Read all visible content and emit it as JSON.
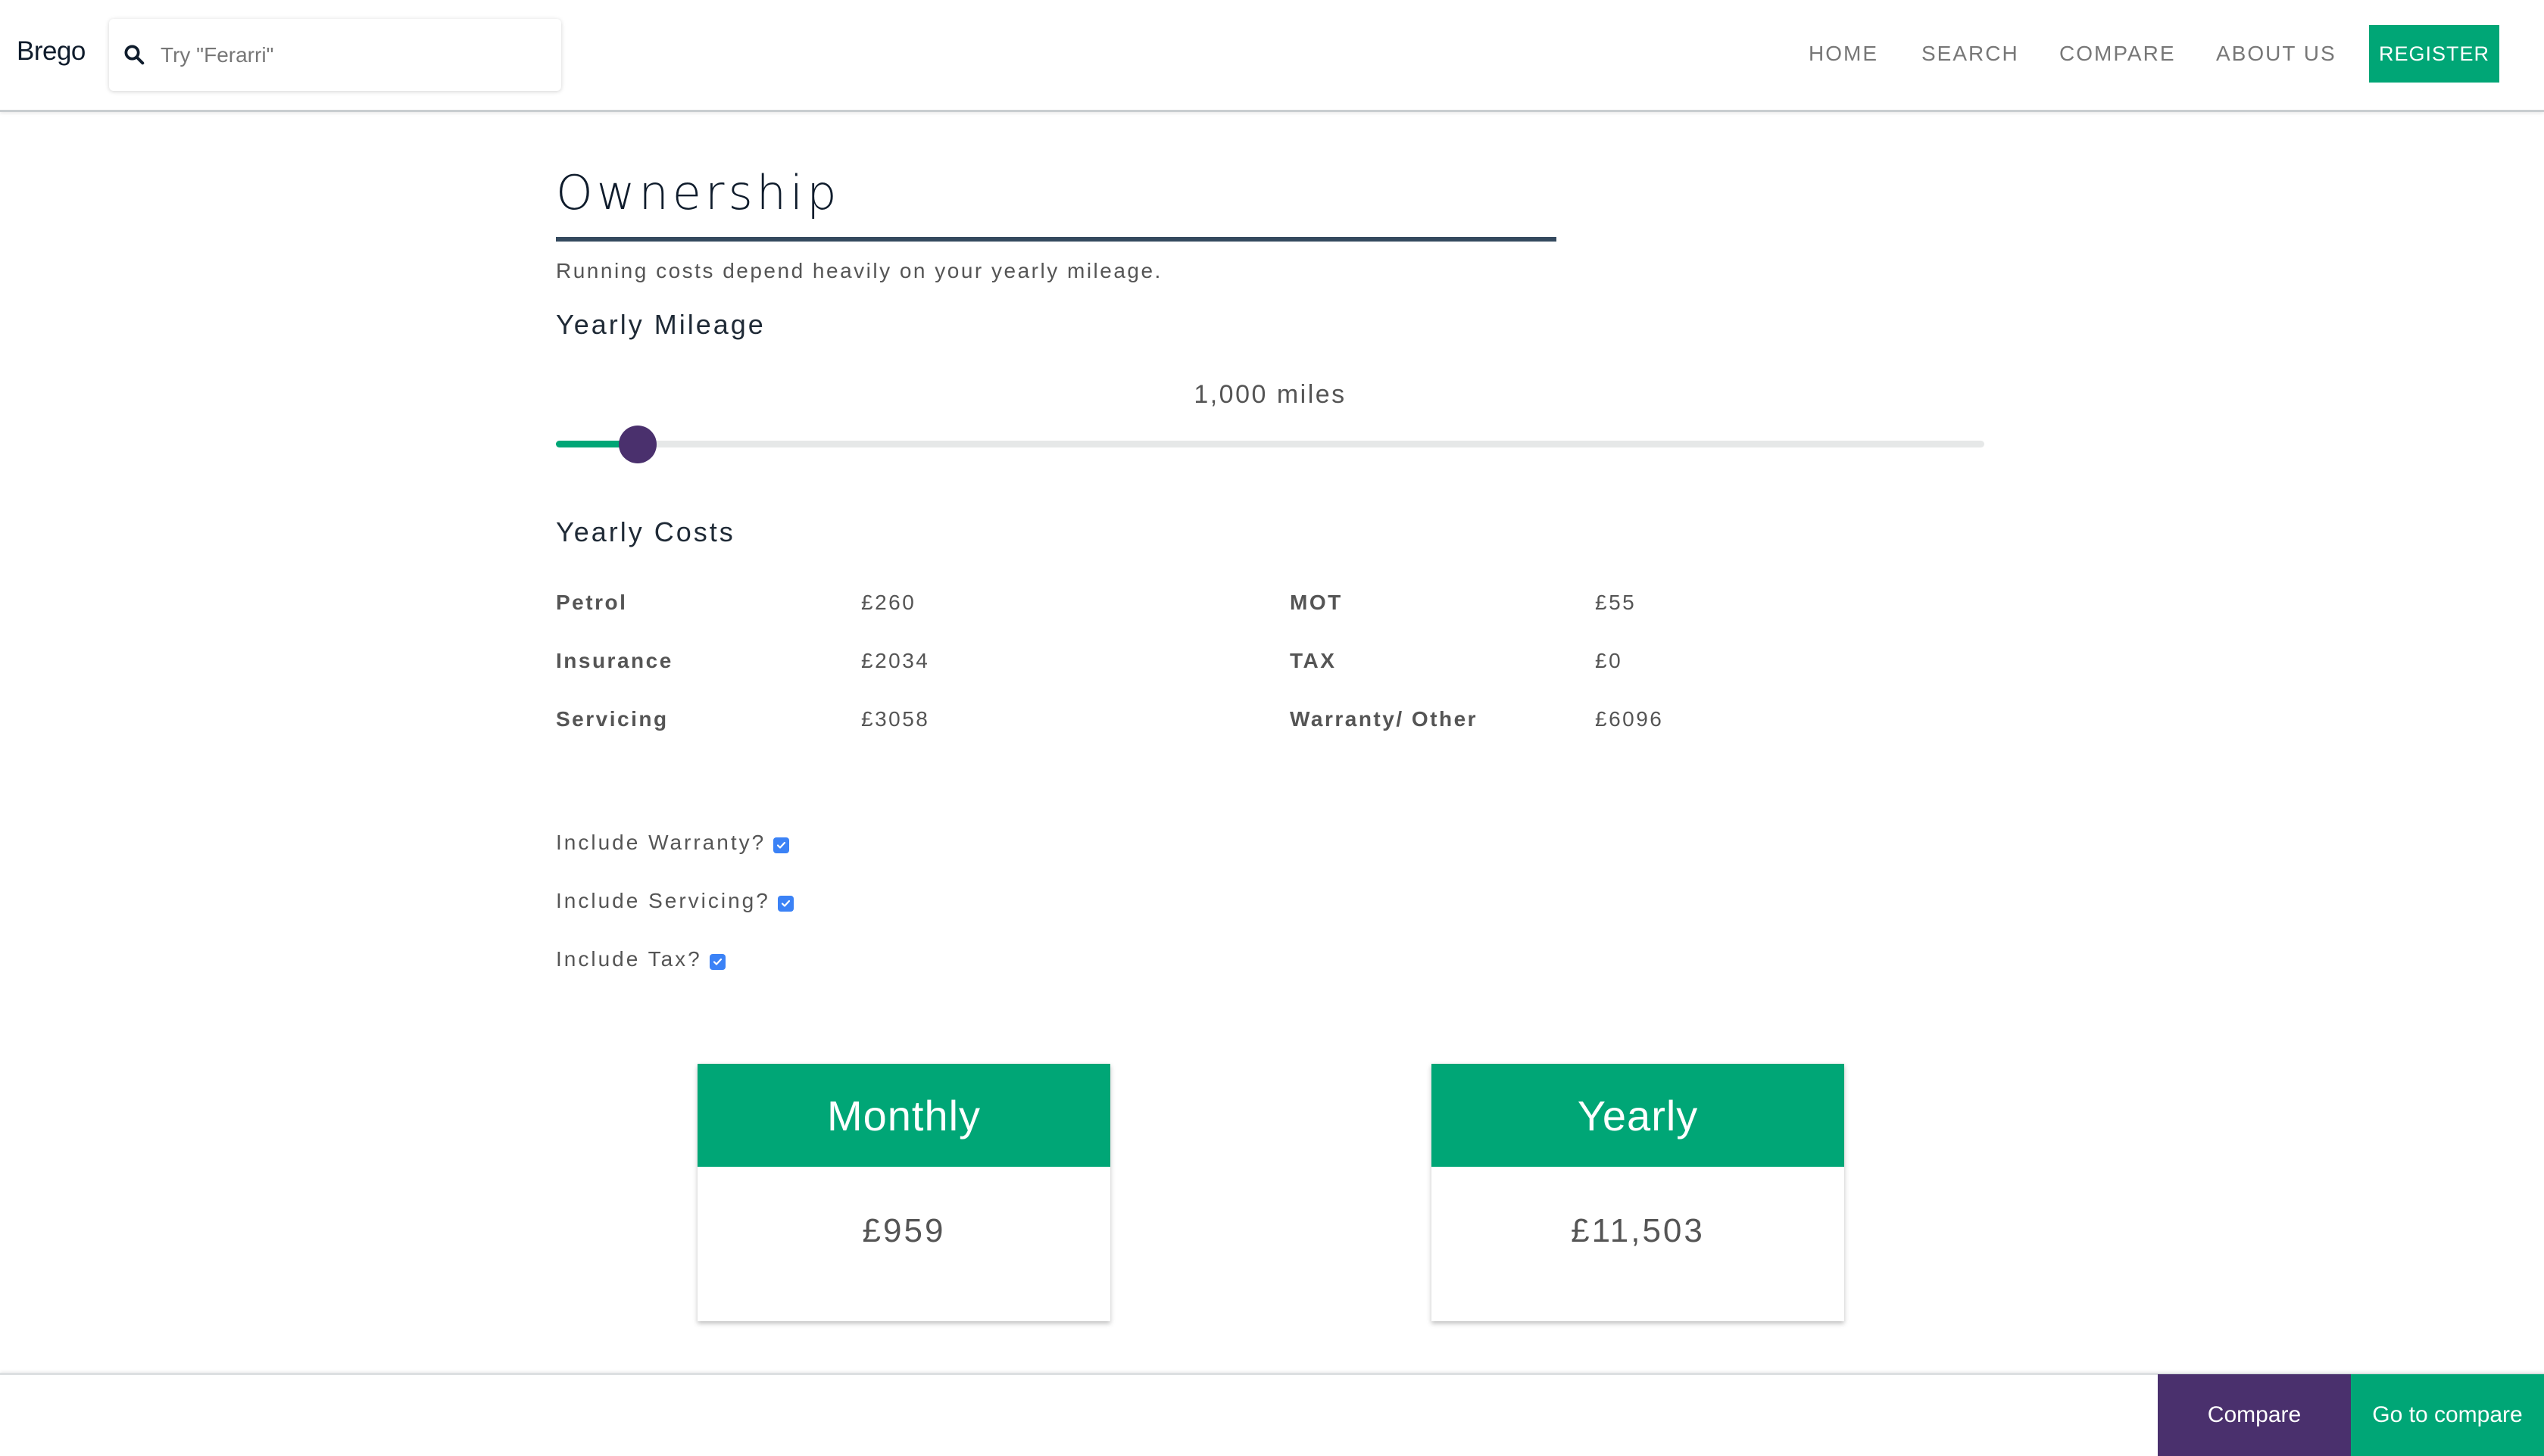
{
  "header": {
    "logo": "Brego",
    "search": {
      "placeholder": "Try \"Ferarri\"",
      "value": ""
    },
    "nav": [
      {
        "label": "HOME"
      },
      {
        "label": "SEARCH"
      },
      {
        "label": "COMPARE"
      },
      {
        "label": "ABOUT US"
      }
    ],
    "register_label": "REGISTER"
  },
  "ownership": {
    "title": "Ownership",
    "subtitle": "Running costs depend heavily on your yearly mileage.",
    "mileage": {
      "label": "Yearly Mileage",
      "value_text": "1,000 miles",
      "slider_fill_fraction": 0.057
    },
    "costs": {
      "label": "Yearly Costs",
      "left": [
        {
          "name": "Petrol",
          "value": "£260"
        },
        {
          "name": "Insurance",
          "value": "£2034"
        },
        {
          "name": "Servicing",
          "value": "£3058"
        }
      ],
      "right": [
        {
          "name": "MOT",
          "value": "£55"
        },
        {
          "name": "TAX",
          "value": "£0"
        },
        {
          "name": "Warranty/ Other",
          "value": "£6096"
        }
      ]
    },
    "options": [
      {
        "label": "Include Warranty?",
        "checked": true
      },
      {
        "label": "Include Servicing?",
        "checked": true
      },
      {
        "label": "Include Tax?",
        "checked": true
      }
    ],
    "summary": {
      "monthly": {
        "label": "Monthly",
        "value": "£959"
      },
      "yearly": {
        "label": "Yearly",
        "value": "£11,503"
      }
    }
  },
  "footer": {
    "compare_label": "Compare",
    "goto_compare_label": "Go to compare"
  },
  "colors": {
    "accent_green": "#00a676",
    "accent_purple": "#4a306d",
    "checkbox_blue": "#3b82f6",
    "title_rule": "#34495e"
  }
}
